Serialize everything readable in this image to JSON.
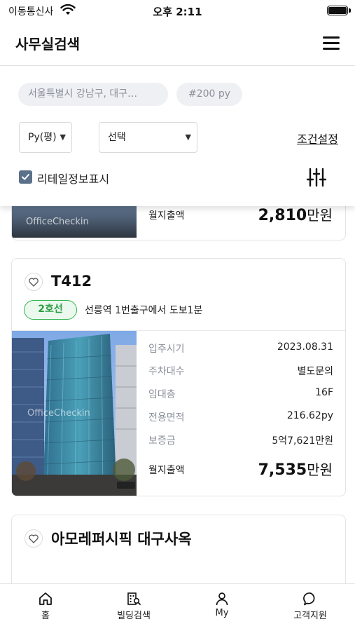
{
  "status_bar": {
    "carrier": "이동통신사",
    "time": "오후 2:11"
  },
  "header": {
    "title": "사무실검색",
    "menu_icon": "hamburger-menu-icon"
  },
  "filters": {
    "location_chip": "서울특별시 강남구, 대구…",
    "size_chip": "#200 py",
    "unit_select": "Py(평)",
    "choice_select": "선택",
    "condition_link": "조건설정",
    "checkbox_label": "리테일정보표시",
    "checkbox_checked": true,
    "filter_icon": "sliders-icon"
  },
  "listings": [
    {
      "price_label": "월지출액",
      "price_number": "2,810",
      "price_unit": "만원",
      "watermark": "OfficeCheckin"
    },
    {
      "title": "T412",
      "subway_line": "2호선",
      "station_info": "선릉역 1번출구에서 도보1분",
      "watermark": "OfficeCheckin",
      "specs": [
        {
          "key": "입주시기",
          "value": "2023.08.31"
        },
        {
          "key": "주차대수",
          "value": "별도문의"
        },
        {
          "key": "임대층",
          "value": "16F"
        },
        {
          "key": "전용면적",
          "value": "216.62py"
        },
        {
          "key": "보증금",
          "value": "5억7,621만원"
        }
      ],
      "price_label": "월지출액",
      "price_number": "7,535",
      "price_unit": "만원"
    },
    {
      "title": "아모레퍼시픽 대구사옥"
    }
  ],
  "colors": {
    "line2_green": "#31b54d",
    "checkbox_fill": "#5a7189",
    "chip_bg": "#eef0f4"
  },
  "bottom_nav": [
    {
      "label": "홈",
      "icon": "home-icon"
    },
    {
      "label": "빌딩검색",
      "icon": "building-search-icon"
    },
    {
      "label": "My",
      "icon": "person-icon"
    },
    {
      "label": "고객지원",
      "icon": "chat-bubble-icon"
    }
  ]
}
